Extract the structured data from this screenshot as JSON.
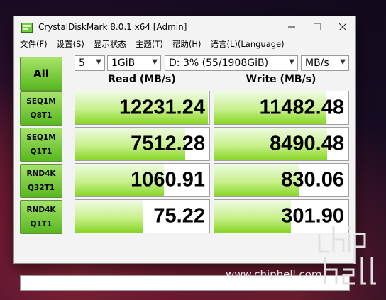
{
  "window": {
    "title": "CrystalDiskMark 8.0.1 x64 [Admin]"
  },
  "menu": [
    {
      "label": "文件(F)"
    },
    {
      "label": "设置(S)"
    },
    {
      "label": "显示状态"
    },
    {
      "label": "主题(T)"
    },
    {
      "label": "帮助(H)"
    },
    {
      "label": "语言(L)(Language)"
    }
  ],
  "controls": {
    "all_label": "All",
    "count": "5",
    "size": "1GiB",
    "drive": "D: 3% (55/1908GiB)",
    "unit": "MB/s"
  },
  "headers": {
    "read": "Read (MB/s)",
    "write": "Write (MB/s)"
  },
  "rows": [
    {
      "line1": "SEQ1M",
      "line2": "Q8T1",
      "read": "12231.24",
      "write": "11482.48",
      "read_fill": 0.99,
      "write_fill": 0.83
    },
    {
      "line1": "SEQ1M",
      "line2": "Q1T1",
      "read": "7512.28",
      "write": "8490.48",
      "read_fill": 0.82,
      "write_fill": 0.84
    },
    {
      "line1": "RND4K",
      "line2": "Q32T1",
      "read": "1060.91",
      "write": "830.06",
      "read_fill": 0.66,
      "write_fill": 0.63
    },
    {
      "line1": "RND4K",
      "line2": "Q1T1",
      "read": "75.22",
      "write": "301.90",
      "read_fill": 0.5,
      "write_fill": 0.57
    }
  ],
  "watermark": "www.chiphell.com",
  "colors": {
    "button_top": "#a6e36a",
    "button_bottom": "#58b71e",
    "bar_green": "#86d524"
  }
}
